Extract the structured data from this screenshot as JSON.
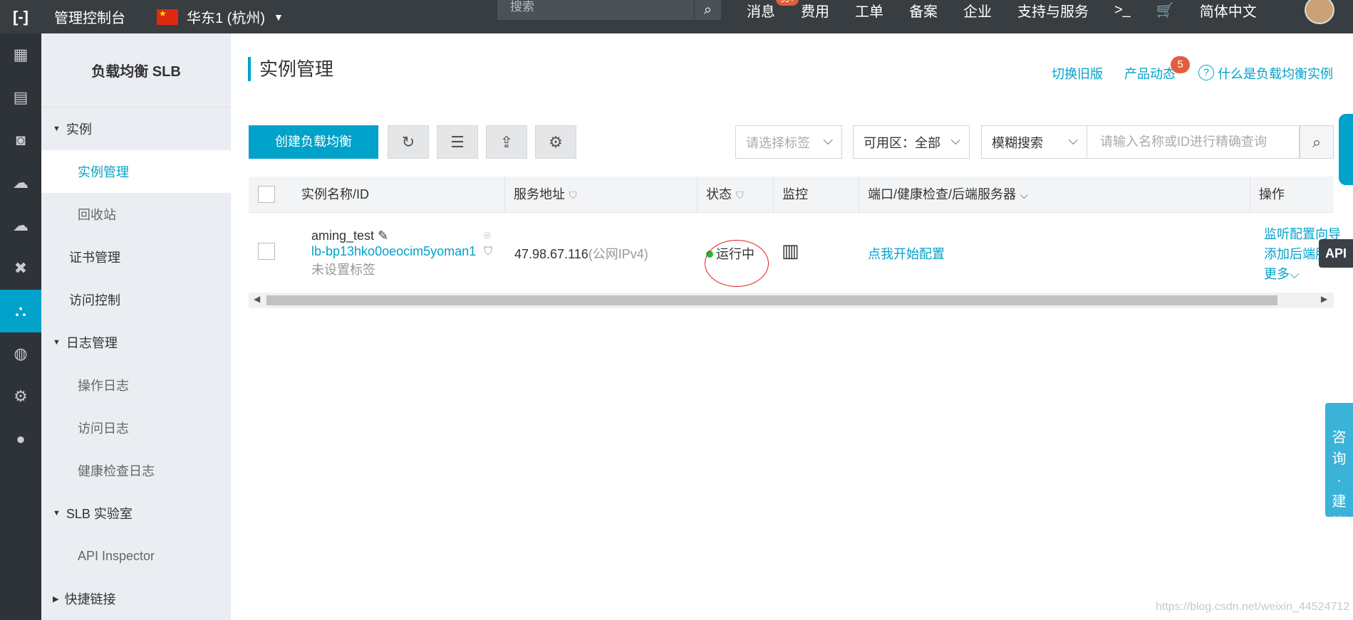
{
  "topbar": {
    "console": "管理控制台",
    "region": "华东1 (杭州)",
    "search_placeholder": "搜索",
    "links": [
      "消息",
      "费用",
      "工单",
      "备案",
      "企业",
      "支持与服务"
    ],
    "msg_badge": "99+",
    "language": "简体中文"
  },
  "sidebar": {
    "title": "负载均衡 SLB",
    "items": [
      {
        "label": "实例",
        "type": "group"
      },
      {
        "label": "实例管理",
        "type": "sub",
        "active": true
      },
      {
        "label": "回收站",
        "type": "sub"
      },
      {
        "label": "证书管理",
        "type": "top"
      },
      {
        "label": "访问控制",
        "type": "top"
      },
      {
        "label": "日志管理",
        "type": "group"
      },
      {
        "label": "操作日志",
        "type": "sub"
      },
      {
        "label": "访问日志",
        "type": "sub"
      },
      {
        "label": "健康检查日志",
        "type": "sub"
      },
      {
        "label": "SLB 实验室",
        "type": "group"
      },
      {
        "label": "API Inspector",
        "type": "sub"
      },
      {
        "label": "快捷链接",
        "type": "group-collapsed"
      }
    ]
  },
  "main": {
    "title": "实例管理",
    "switch_old": "切换旧版",
    "product_news": "产品动态",
    "product_badge": "5",
    "what_is": "什么是负载均衡实例",
    "create_button": "创建负载均衡",
    "tag_select_placeholder": "请选择标签",
    "zone_select": "可用区：全部",
    "search_mode": "模糊搜索",
    "search_placeholder": "请输入名称或ID进行精确查询"
  },
  "table": {
    "headers": [
      "实例名称/ID",
      "服务地址",
      "状态",
      "监控",
      "端口/健康检查/后端服务器",
      "操作"
    ],
    "row": {
      "name": "aming_test",
      "id": "lb-bp13hko0oeocim5yoman1",
      "tag": "未设置标签",
      "ip": "47.98.67.116",
      "ip_type": "(公网IPv4)",
      "status": "运行中",
      "config_link": "点我开始配置",
      "actions": [
        "监听配置向导",
        "添加后端服",
        "更多"
      ]
    }
  },
  "floating": {
    "api": "API",
    "consult": [
      "咨",
      "询",
      "·",
      "建",
      "议"
    ]
  },
  "watermark": "https://blog.csdn.net/weixin_44524712",
  "colors": {
    "accent": "#00a2ca",
    "topbar": "#373d41",
    "running": "#1fbd3a"
  }
}
